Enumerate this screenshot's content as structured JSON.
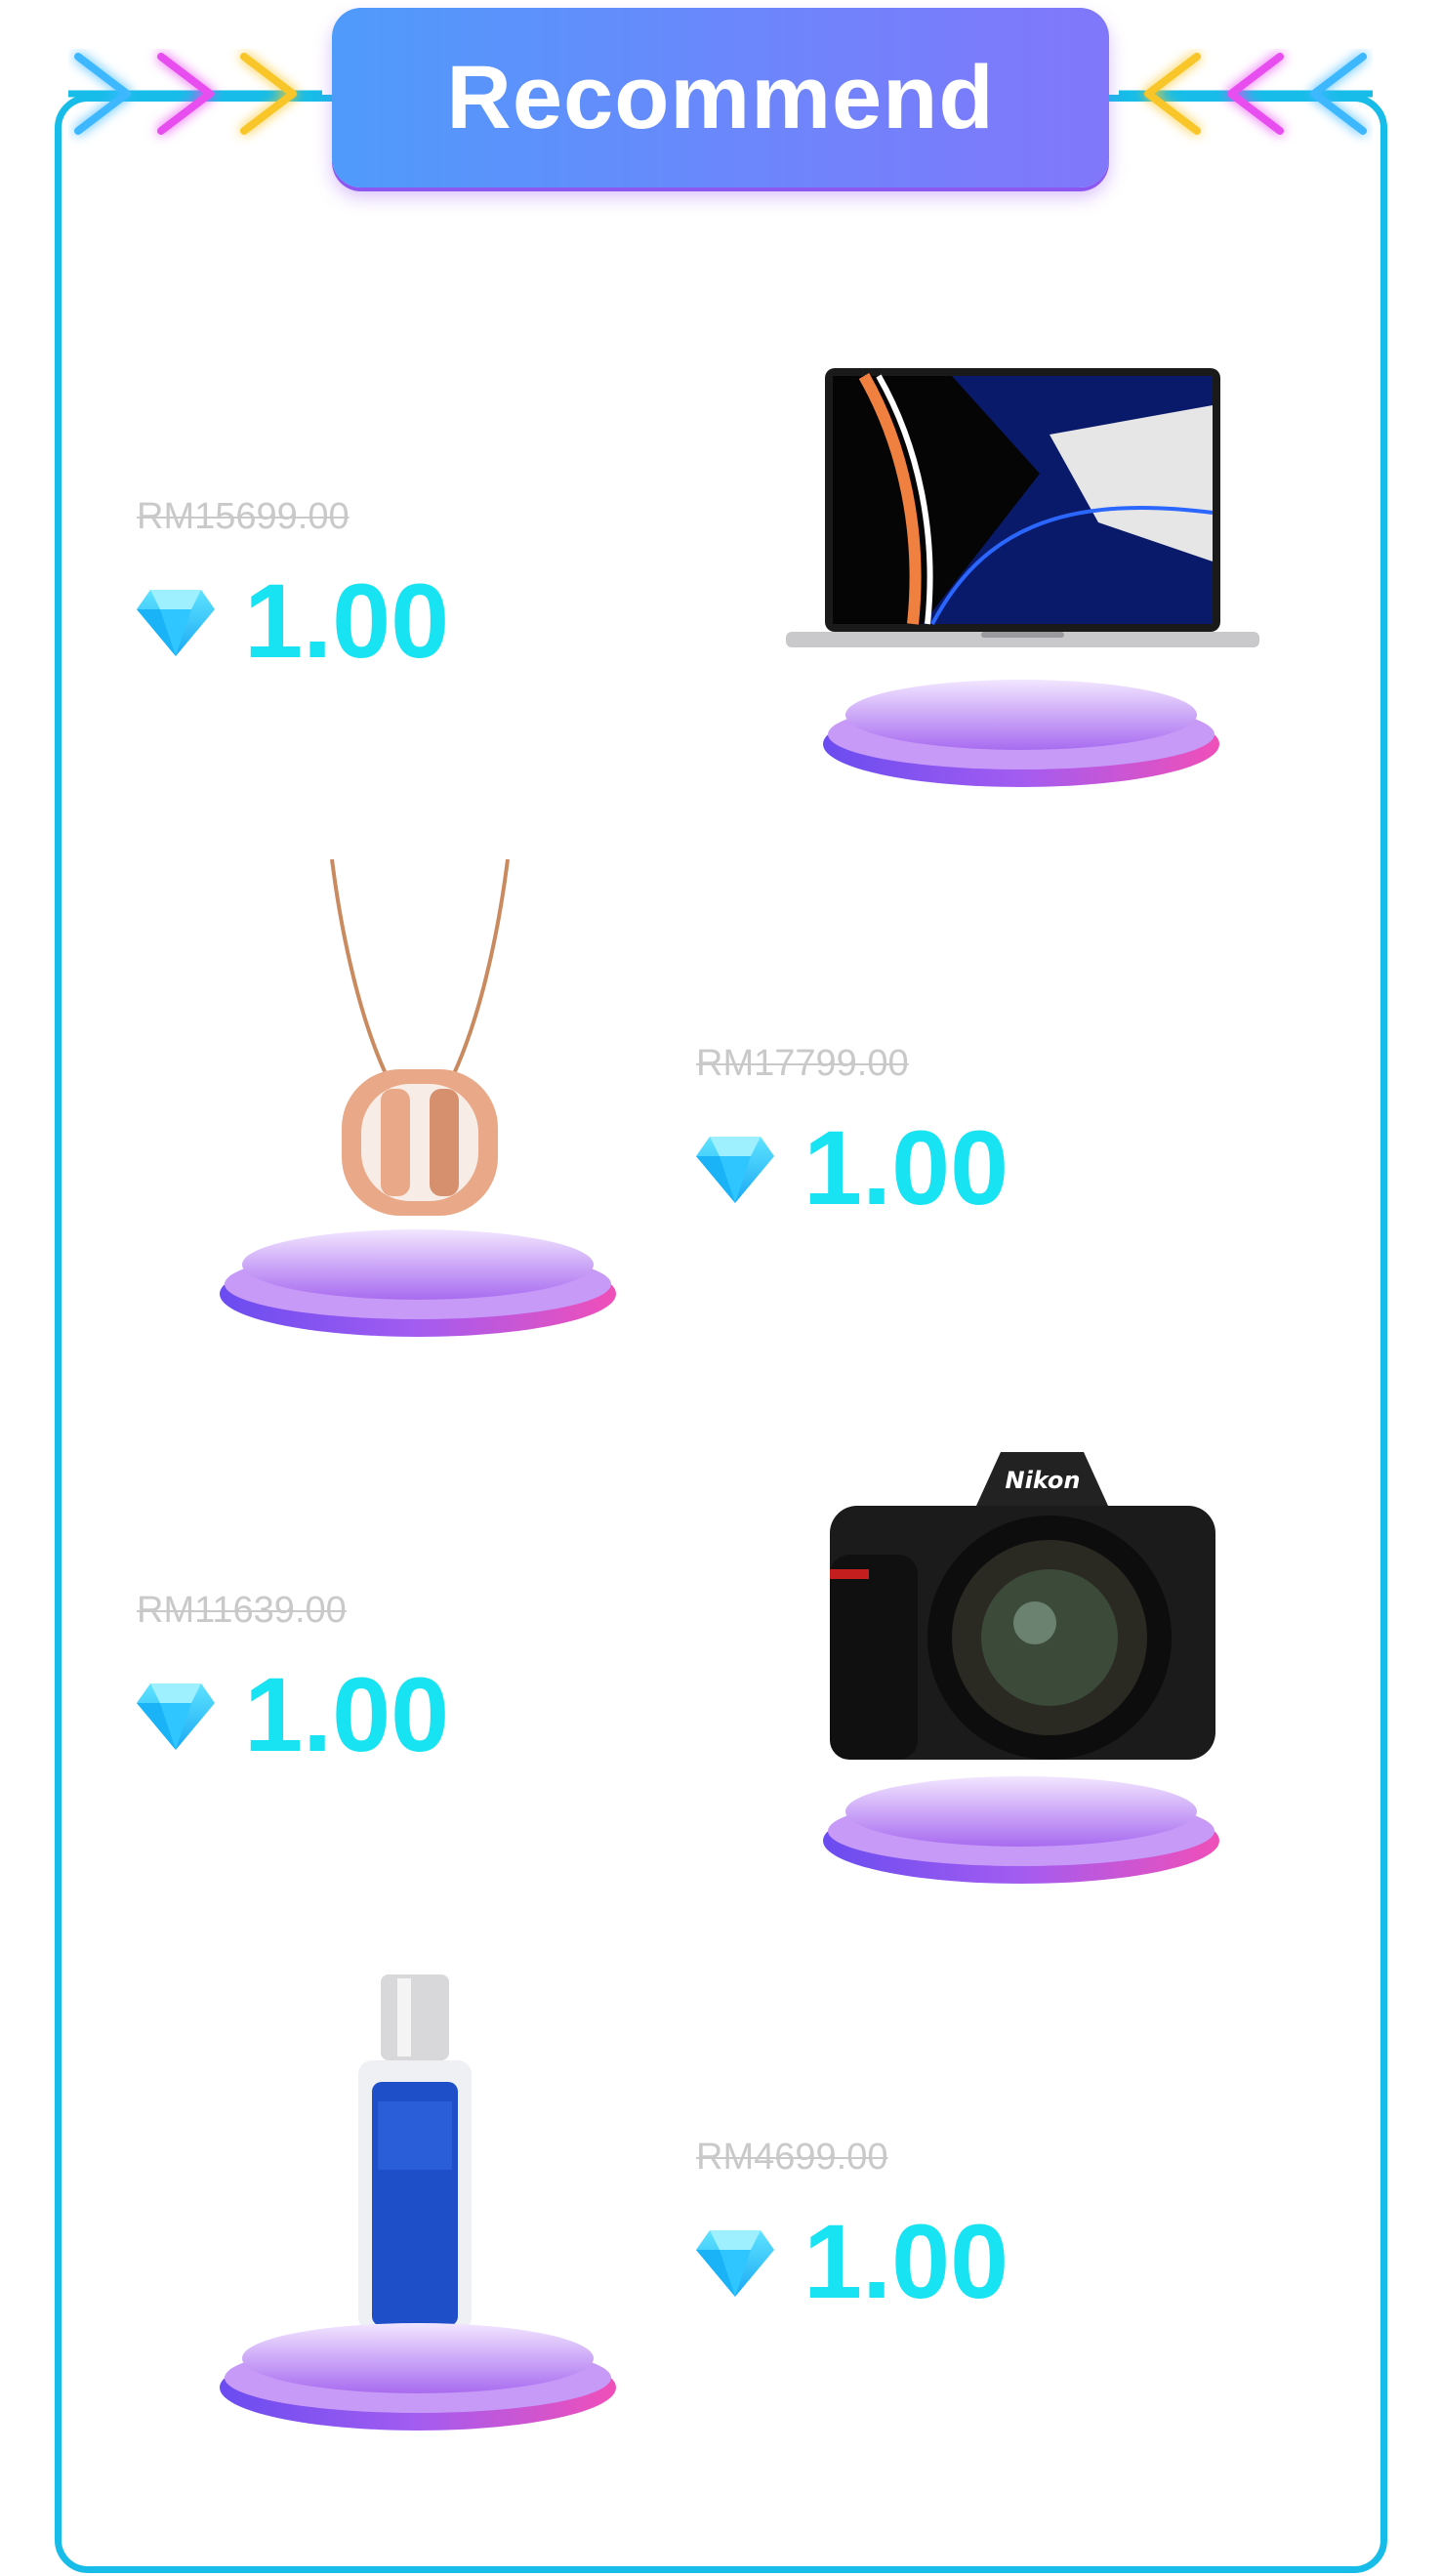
{
  "header": {
    "title": "Recommend"
  },
  "currency_icon": "diamond-icon",
  "products": [
    {
      "name": "laptop",
      "old_price": "RM15699.00",
      "price": "1.00"
    },
    {
      "name": "necklace",
      "old_price": "RM17799.00",
      "price": "1.00"
    },
    {
      "name": "camera",
      "old_price": "RM11639.00",
      "price": "1.00"
    },
    {
      "name": "serum",
      "old_price": "RM4699.00",
      "price": "1.00"
    }
  ],
  "colors": {
    "frame": "#17bde8",
    "price": "#18e3f2",
    "old_price": "#c9c9c9",
    "pill_start": "#4f9bfb",
    "pill_end": "#8177fb",
    "pedestal": "#a35cf0"
  }
}
